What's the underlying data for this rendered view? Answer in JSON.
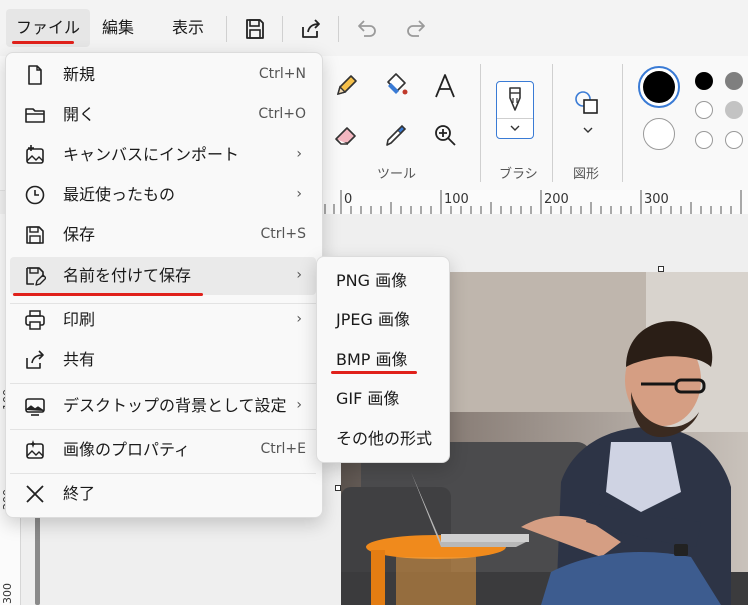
{
  "menubar": {
    "file": "ファイル",
    "edit": "編集",
    "view": "表示"
  },
  "ribbon": {
    "tools_label": "ツール",
    "brush_label": "ブラシ",
    "shapes_label": "図形",
    "colors": {
      "primary": "#000000",
      "secondary": "#ffffff",
      "swatch_black": "#000000",
      "swatch_gray": "#7f7f7f",
      "swatch_silver": "#c3c3c3",
      "accent_blue": "#3a7bd5"
    }
  },
  "ruler": {
    "h_ticks": [
      "0",
      "100",
      "200",
      "300"
    ],
    "v_ticks": [
      "100",
      "200",
      "300"
    ]
  },
  "file_menu": {
    "new": {
      "label": "新規",
      "shortcut": "Ctrl+N"
    },
    "open": {
      "label": "開く",
      "shortcut": "Ctrl+O"
    },
    "import": {
      "label": "キャンバスにインポート"
    },
    "recent": {
      "label": "最近使ったもの"
    },
    "save": {
      "label": "保存",
      "shortcut": "Ctrl+S"
    },
    "save_as": {
      "label": "名前を付けて保存"
    },
    "print": {
      "label": "印刷"
    },
    "share": {
      "label": "共有"
    },
    "set_desktop": {
      "label": "デスクトップの背景として設定"
    },
    "properties": {
      "label": "画像のプロパティ",
      "shortcut": "Ctrl+E"
    },
    "exit": {
      "label": "終了"
    },
    "chevron": "›"
  },
  "save_as_menu": {
    "png": "PNG 画像",
    "jpeg": "JPEG 画像",
    "bmp": "BMP 画像",
    "gif": "GIF 画像",
    "other": "その他の形式"
  }
}
